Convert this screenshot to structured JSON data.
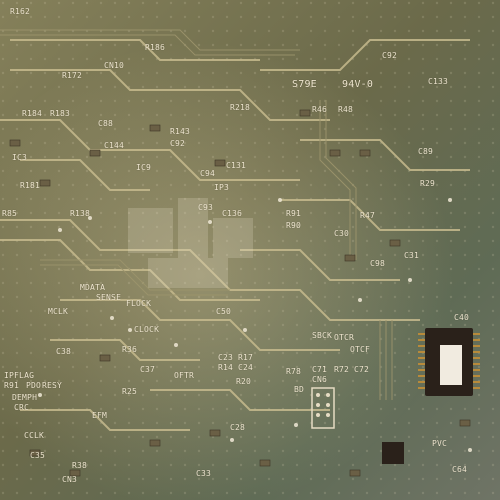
{
  "labels": {
    "l1": "R162",
    "l2": "R186",
    "l3": "C92",
    "l4": "R172",
    "l5": "CN10",
    "l6": "R184",
    "l7": "R183",
    "l8": "S79E",
    "l9": "94V-0",
    "l10": "C133",
    "l11": "R218",
    "l12": "R46",
    "l13": "R48",
    "l14": "C88",
    "l15": "R143",
    "l16": "C92",
    "l17": "C144",
    "l18": "C89",
    "l19": "C131",
    "l20": "IC3",
    "l21": "IC9",
    "l22": "C94",
    "l23": "IP3",
    "l24": "C93",
    "l25": "R181",
    "l26": "R85",
    "l27": "R138",
    "l28": "C136",
    "l29": "R91",
    "l30": "R90",
    "l31": "MDATA",
    "l32": "SENSE",
    "l33": "FLOCK",
    "l34": "MCLK",
    "l35": "C50",
    "l36": "CLOCK",
    "l37": "SBCK",
    "l38": "OTCR",
    "l39": "OTCF",
    "l40": "C40",
    "l41": "R36",
    "l42": "C38",
    "l43": "IPFLAG",
    "l44": "R91",
    "l45": "PDO",
    "l46": "RESY",
    "l47": "DEMPH",
    "l48": "CRC",
    "l49": "C37",
    "l50": "C23",
    "l51": "R17",
    "l52": "R14",
    "l53": "C24",
    "l54": "R20",
    "l55": "C71",
    "l56": "R72",
    "l57": "C72",
    "l58": "CN6",
    "l59": "R78",
    "l60": "C35",
    "l61": "C28",
    "l62": "CCLK",
    "l63": "R38",
    "l64": "C33",
    "l65": "CN3",
    "l66": "PVC",
    "l67": "R25",
    "l68": "R29",
    "l69": "C31",
    "l70": "C30",
    "l71": "C98",
    "l72": "R47",
    "l73": "C64",
    "l74": "EFM",
    "l75": "BD",
    "l76": "OFTR"
  },
  "watermark": "vintage-photo-stock-mark"
}
